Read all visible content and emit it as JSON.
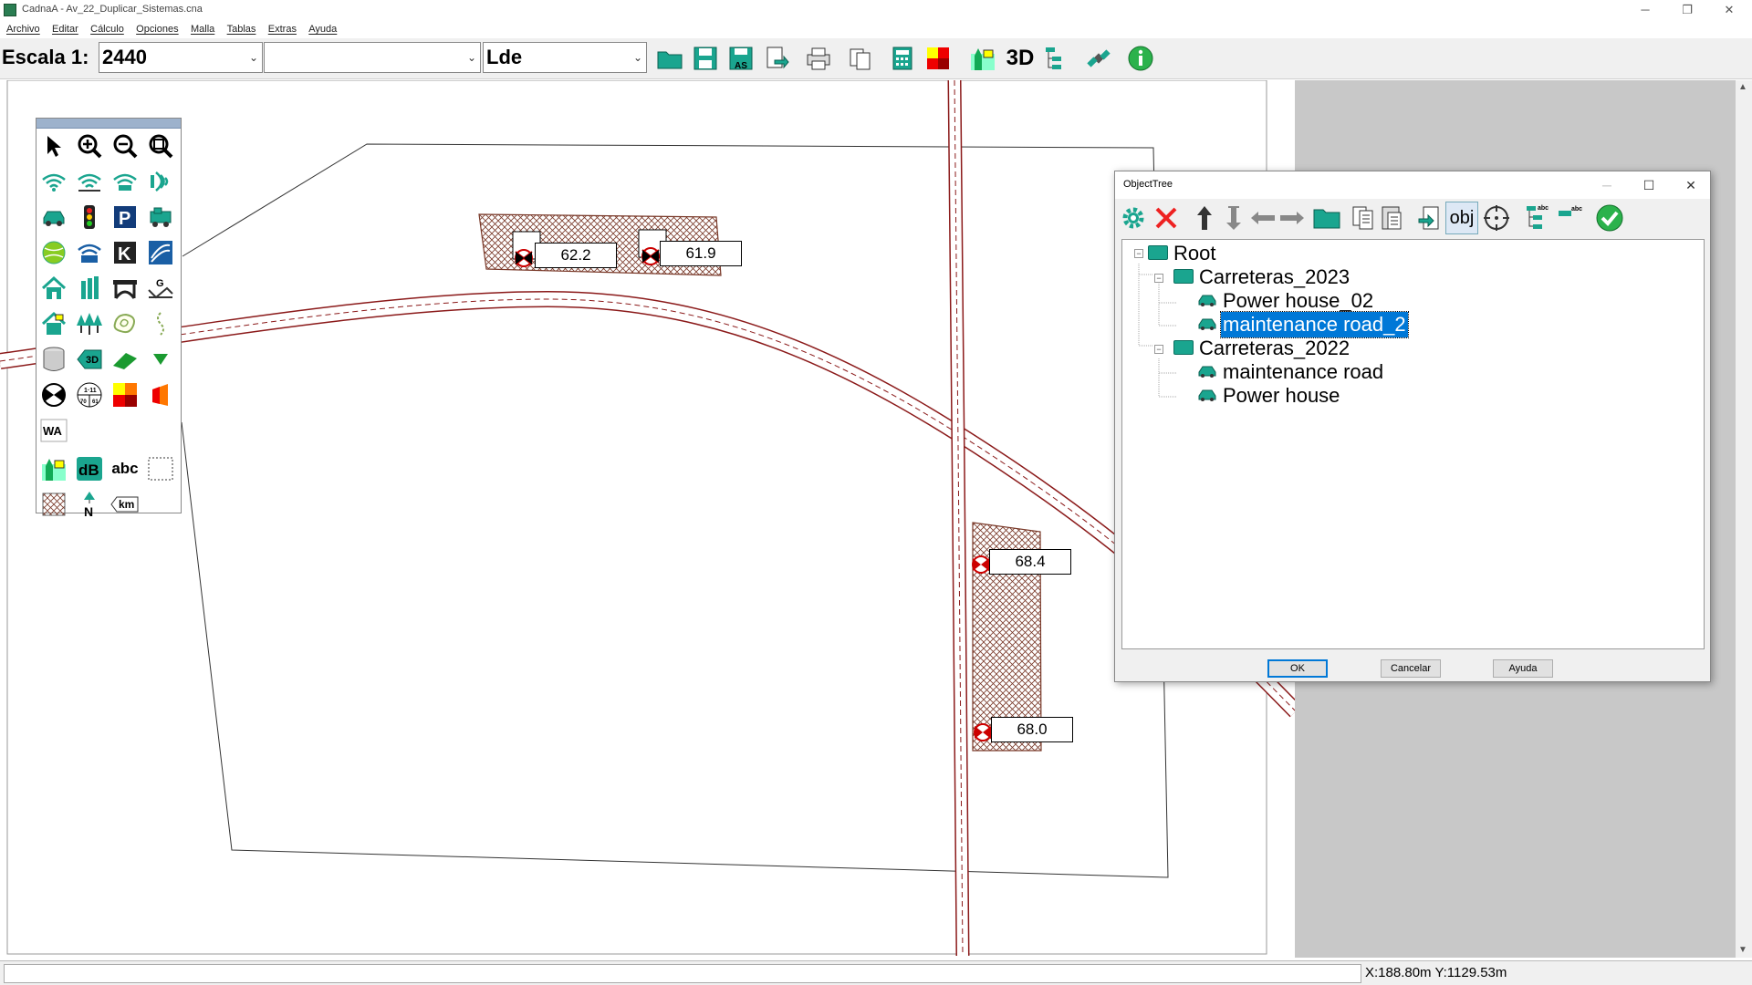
{
  "window": {
    "title": "CadnaA - Av_22_Duplicar_Sistemas.cna",
    "minimize": "─",
    "restore": "❐",
    "close": "✕"
  },
  "menu": [
    "Archivo",
    "Editar",
    "Cálculo",
    "Opciones",
    "Malla",
    "Tablas",
    "Extras",
    "Ayuda"
  ],
  "toolbar": {
    "scale_label": "Escala 1:",
    "scale_value": "2440",
    "layer_value": "",
    "variable_value": "Lde",
    "btn_3d": "3D"
  },
  "map": {
    "labels": [
      {
        "id": "r1",
        "value": "62.2"
      },
      {
        "id": "r2",
        "value": "61.9"
      },
      {
        "id": "r3",
        "value": "68.4"
      },
      {
        "id": "r4",
        "value": "68.0"
      }
    ]
  },
  "palette": {
    "wa": "WA",
    "db": "dB",
    "abc": "abc",
    "km": "km",
    "north": "N",
    "three_d": "3D"
  },
  "dialog": {
    "title": "ObjectTree",
    "obj_button": "obj",
    "tree": {
      "root": "Root",
      "group1": "Carreteras_2023",
      "g1_item1": "Power house_02",
      "g1_item2": "maintenance road_2",
      "group2": "Carreteras_2022",
      "g2_item1": "maintenance road",
      "g2_item2": "Power house"
    },
    "ok": "OK",
    "cancel": "Cancelar",
    "help": "Ayuda"
  },
  "status": {
    "coords": "X:188.80m Y:1129.53m"
  },
  "colors": {
    "road": "#8b1a1a",
    "building_hatch": "#7a3a2a",
    "selection": "#0078d7",
    "folder": "#1aa58f",
    "ok_green": "#2bb24c"
  }
}
